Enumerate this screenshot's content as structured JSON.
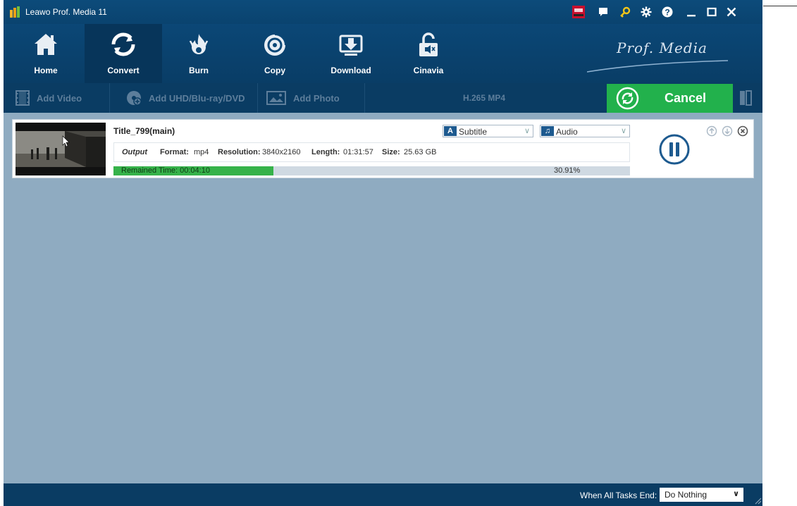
{
  "window": {
    "title": "Leawo Prof. Media 11"
  },
  "nav": {
    "items": [
      {
        "label": "Home",
        "icon": "home-icon"
      },
      {
        "label": "Convert",
        "icon": "convert-icon",
        "active": true
      },
      {
        "label": "Burn",
        "icon": "burn-icon"
      },
      {
        "label": "Copy",
        "icon": "copy-icon"
      },
      {
        "label": "Download",
        "icon": "download-icon"
      },
      {
        "label": "Cinavia",
        "icon": "cinavia-icon"
      }
    ],
    "brand": "Prof. Media"
  },
  "toolbar": {
    "add_video": "Add Video",
    "add_disc": "Add UHD/Blu-ray/DVD",
    "add_photo": "Add Photo",
    "format": "H.265 MP4",
    "cancel": "Cancel"
  },
  "task": {
    "title": "Title_799(main)",
    "subtitle": "Subtitle",
    "audio": "Audio",
    "output_label": "Output",
    "format_key": "Format:",
    "format_val": "mp4",
    "resolution_key": "Resolution:",
    "resolution_val": "3840x2160",
    "length_key": "Length:",
    "length_val": "01:31:57",
    "size_key": "Size:",
    "size_val": "25.63 GB",
    "remained": "Remained Time: 00:04:10",
    "percent_text": "30.91%",
    "progress": 0.3091
  },
  "status": {
    "label": "When All Tasks End:",
    "option": "Do Nothing"
  },
  "colors": {
    "titlebar": "#0c4b7a",
    "accent_green": "#22b14c",
    "workspace": "#8fabc1"
  }
}
